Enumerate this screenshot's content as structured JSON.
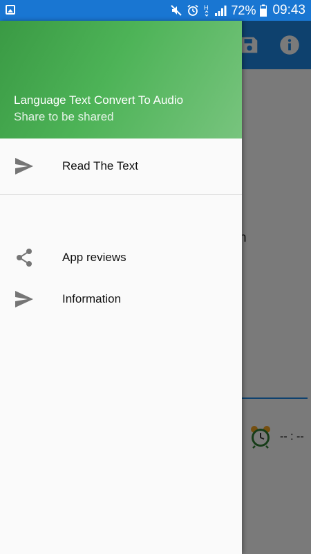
{
  "status_bar": {
    "battery_percent": "72%",
    "time": "09:43",
    "icons": [
      "gallery-icon",
      "mute-icon",
      "alarm-icon",
      "h-plus-icon",
      "signal-icon",
      "battery-icon"
    ]
  },
  "background_app": {
    "toolbar_icons": [
      "save-icon",
      "info-icon"
    ],
    "text_fragment": "n",
    "time_placeholder": "-- : --"
  },
  "drawer": {
    "header": {
      "title": "Language Text Convert To Audio",
      "subtitle": "Share to be shared"
    },
    "items": [
      {
        "label": "Read The Text",
        "icon": "send-icon"
      },
      {
        "label": "App reviews",
        "icon": "share-icon"
      },
      {
        "label": "Information",
        "icon": "send-icon"
      }
    ]
  },
  "colors": {
    "status_bar": "#1976d2",
    "toolbar": "#1e88e5",
    "drawer_header_start": "#3a9a44",
    "drawer_header_end": "#78c47e",
    "drawer_background": "#fafafa"
  }
}
